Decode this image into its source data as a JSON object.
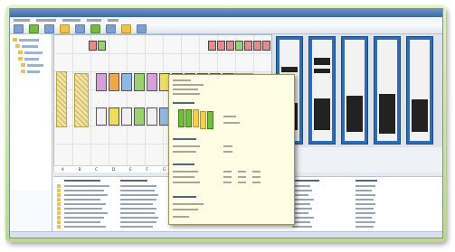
{
  "window": {
    "title": ""
  },
  "menu": {
    "items": []
  },
  "floor_ruler": {
    "labels": [
      "A",
      "B",
      "C",
      "D",
      "E",
      "F",
      "G",
      "H",
      "I",
      "J",
      "K",
      "L",
      "M"
    ]
  },
  "colors": {
    "frame_green": "#b9d98b",
    "title_blue": "#3d6aa6",
    "cabinet_blue": "#2e6db6",
    "tooltip_bg": "#fffde3",
    "hatch_yellow": "#d9c36b",
    "rack_purple": "#d6a0d8",
    "rack_orange": "#f0a64a",
    "rack_green": "#9cd172",
    "rack_red": "#e68a8a"
  },
  "icons": [
    "folder-icon",
    "server-rack-icon",
    "toolbar-button-icon",
    "device-icon"
  ]
}
